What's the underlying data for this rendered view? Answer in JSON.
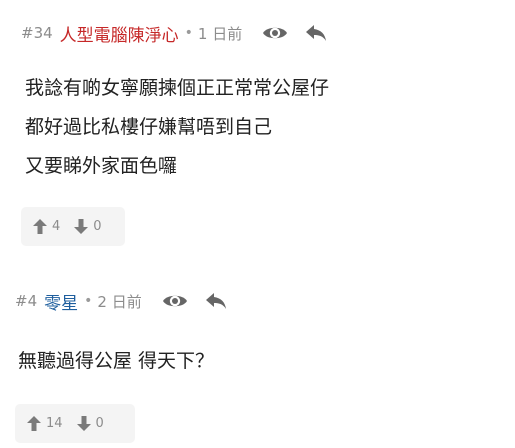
{
  "posts": [
    {
      "floor": "#34",
      "author": "人型電腦陳淨心",
      "separator": "•",
      "time": "1 日前",
      "lines": [
        "我諗有啲女寧願揀個正正常常公屋仔",
        "都好過比私樓仔嫌幫唔到自己",
        "又要睇外家面色囉"
      ],
      "upvotes": "4",
      "downvotes": "0",
      "author_color": "#c62828"
    },
    {
      "floor": "#4",
      "author": "零星",
      "separator": "•",
      "time": "2 日前",
      "lines": [
        "無聽過得公屋 得天下？"
      ],
      "upvotes": "14",
      "downvotes": "0",
      "author_color": "#1f5f9e"
    }
  ],
  "icons": {
    "view": "eye-icon",
    "reply": "reply-arrow-icon",
    "upvote": "arrow-up-icon",
    "downvote": "arrow-down-icon"
  }
}
